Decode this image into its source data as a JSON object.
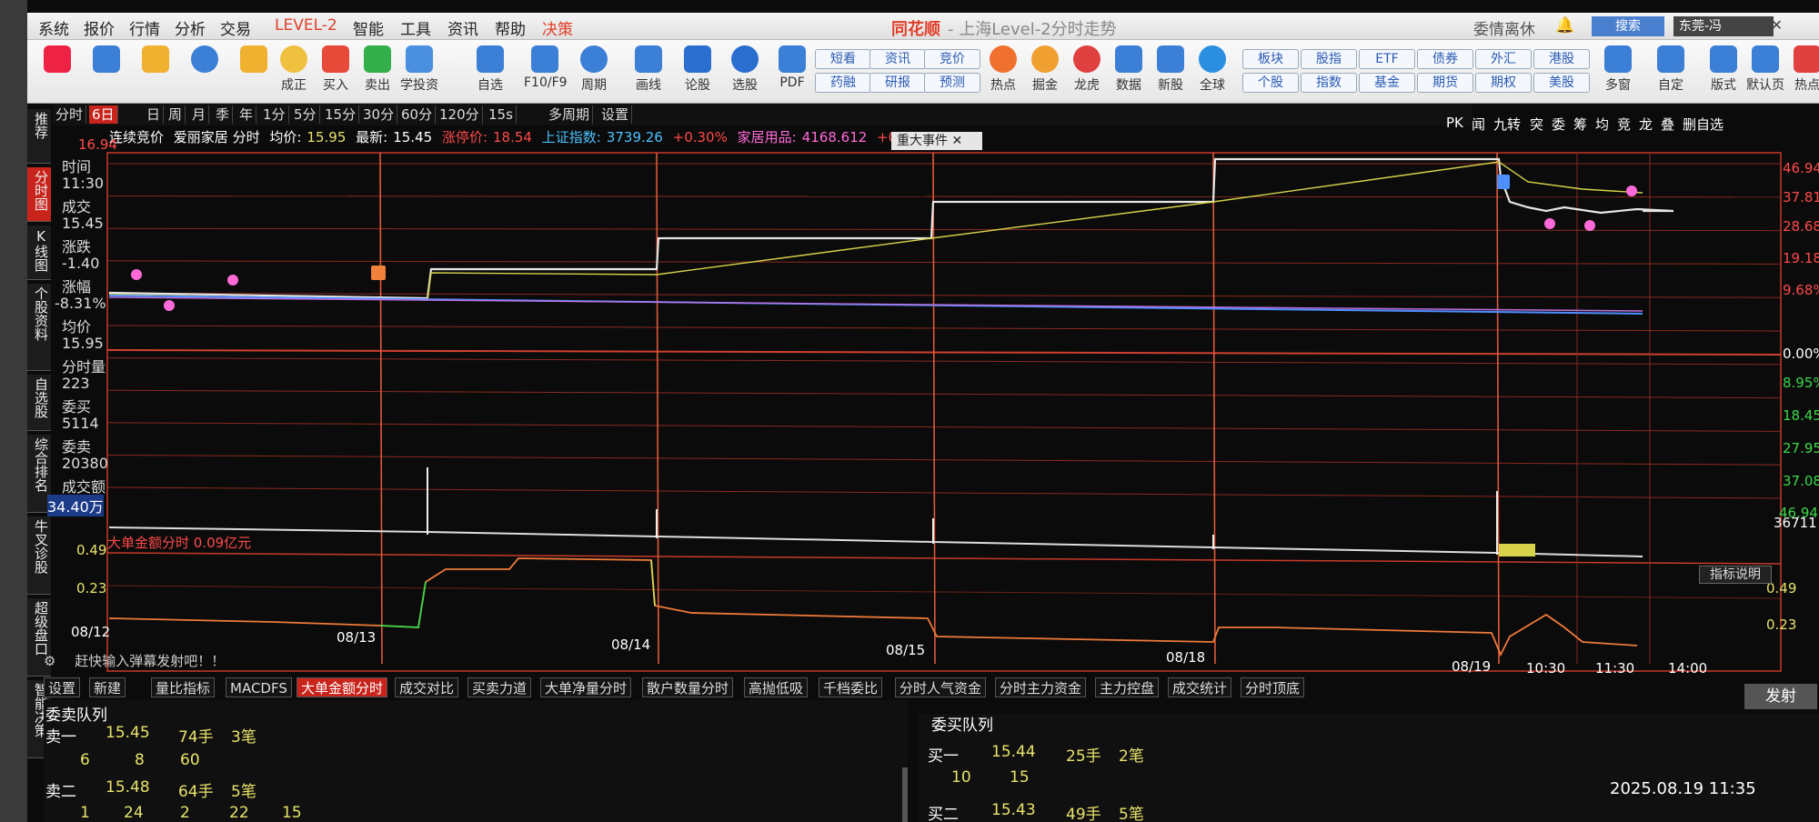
{
  "menubar": {
    "items": [
      "系统",
      "报价",
      "行情",
      "分析",
      "交易",
      "LEVEL-2",
      "智能",
      "工具",
      "资讯",
      "帮助",
      "决策"
    ],
    "brand": "同花顺",
    "title": "- 上海Level-2分时走势",
    "window_right": "委情离休",
    "search_label": "搜索",
    "user_label": "东莞-冯"
  },
  "toolbar": {
    "buttons": [
      "成正",
      "买入",
      "卖出",
      "学投资",
      "自选",
      "F10/F9",
      "周期",
      "画线",
      "论股",
      "选股",
      "PDF"
    ],
    "pairs": [
      [
        "短看",
        "药融"
      ],
      [
        "资讯",
        "研报"
      ],
      [
        "竞价",
        "预测"
      ]
    ],
    "buttons2": [
      "热点",
      "掘金",
      "龙虎",
      "数据",
      "新股",
      "全球"
    ],
    "pairs2": [
      [
        "板块",
        "个股"
      ],
      [
        "股指",
        "指数"
      ],
      [
        "ETF",
        "基金"
      ],
      [
        "债券",
        "期货"
      ],
      [
        "外汇",
        "期权"
      ],
      [
        "港股",
        "美股"
      ]
    ],
    "buttons3": [
      "多窗",
      "自定",
      "版式",
      "默认页",
      "热点"
    ]
  },
  "period_tabs": [
    "分时",
    "6日",
    "日",
    "周",
    "月",
    "季",
    "年",
    "1分",
    "5分",
    "15分",
    "30分",
    "60分",
    "120分",
    "15s",
    "多周期",
    "设置"
  ],
  "period_active": "6日",
  "right_icons": [
    "PK",
    "闻",
    "九转",
    "突",
    "委",
    "筹",
    "均",
    "竞",
    "龙",
    "叠",
    "删自选"
  ],
  "info": {
    "auction": "连续竞价",
    "stock": "爱丽家居 分时",
    "avg_label": "均价:",
    "avg": "15.95",
    "last_label": "最新:",
    "last": "15.45",
    "limit_label": "涨停价:",
    "limit": "18.54",
    "index_label": "上证指数:",
    "index": "3739.26",
    "index_chg": "+0.30%",
    "sector_label": "家居用品:",
    "sector": "4168.612",
    "sector_chg": "+0",
    "event": "重大事件"
  },
  "side_tabs": [
    "推荐",
    "分时图",
    "K线图",
    "个股资料",
    "自选股",
    "综合排名",
    "牛叉诊股",
    "超级盘口",
    "智能决策"
  ],
  "data_panel": {
    "time_label": "时间",
    "time": "11:30",
    "price_label": "成交",
    "price": "15.45",
    "chg_label": "涨跌",
    "chg": "-1.40",
    "pct_label": "涨幅",
    "pct": "-8.31%",
    "avg_label": "均价",
    "avg": "15.95",
    "vol_label": "分时量",
    "vol": "223",
    "bid_label": "委买",
    "bid": "5114",
    "ask_label": "委卖",
    "ask": "20380",
    "amt_label": "成交额",
    "amt": "34.40万"
  },
  "chart": {
    "left_top": "16.94",
    "right_prices": [
      "46.94",
      "37.81",
      "28.68",
      "19.18",
      "9.68%",
      "0.00%",
      "8.95%",
      "18.45",
      "27.95",
      "37.08",
      "46.94%"
    ],
    "vol_right": "36711",
    "ind_left_top": "0.49",
    "ind_left_mid": "0.23",
    "ind_right_top": "0.49",
    "ind_right_mid": "0.23",
    "ind_title": "大单金额分时 0.09亿元",
    "dates": [
      "08/12",
      "08/13",
      "08/14",
      "08/15",
      "08/18",
      "08/19"
    ],
    "times": [
      "10:30",
      "11:30",
      "14:00"
    ],
    "explain": "指标说明"
  },
  "chart_data": {
    "type": "line",
    "title": "",
    "x": [
      "08/12",
      "08/13",
      "08/14",
      "08/15",
      "08/18",
      "08/19 09:30",
      "08/19 10:30",
      "08/19 11:30"
    ],
    "series": [
      {
        "name": "分时",
        "values": [
          16.85,
          17.1,
          17.5,
          17.85,
          18.54,
          18.54,
          17.6,
          17.1
        ]
      }
    ],
    "ylim": [
      0,
      18.54
    ]
  },
  "indicator_tabs": [
    "设置",
    "新建",
    "量比指标",
    "MACDFS",
    "大单金额分时",
    "成交对比",
    "买卖力道",
    "大单净量分时",
    "散户数量分时",
    "高抛低吸",
    "千档委比",
    "分时人气资金",
    "分时主力资金",
    "主力控盘",
    "成交统计",
    "分时顶底"
  ],
  "indicator_active": "大单金额分时",
  "danmu": "赶快输入弹幕发射吧！！",
  "send": "发射",
  "orderbook": {
    "ask_title": "委卖队列",
    "bid_title": "委买队列",
    "ask1_label": "卖一",
    "ask1_price": "15.45",
    "ask1_vol": "74手",
    "ask1_cnt": "3笔",
    "ask1_q": [
      "6",
      "8",
      "60"
    ],
    "ask2_label": "卖二",
    "ask2_price": "15.48",
    "ask2_vol": "64手",
    "ask2_cnt": "5笔",
    "ask2_q": [
      "1",
      "24",
      "2",
      "22",
      "15"
    ],
    "bid1_label": "买一",
    "bid1_price": "15.44",
    "bid1_vol": "25手",
    "bid1_cnt": "2笔",
    "bid1_q": [
      "10",
      "15"
    ],
    "bid2_label": "买二",
    "bid2_price": "15.43",
    "bid2_vol": "49手",
    "bid2_cnt": "5笔"
  },
  "timestamp": "2025.08.19 11:35"
}
